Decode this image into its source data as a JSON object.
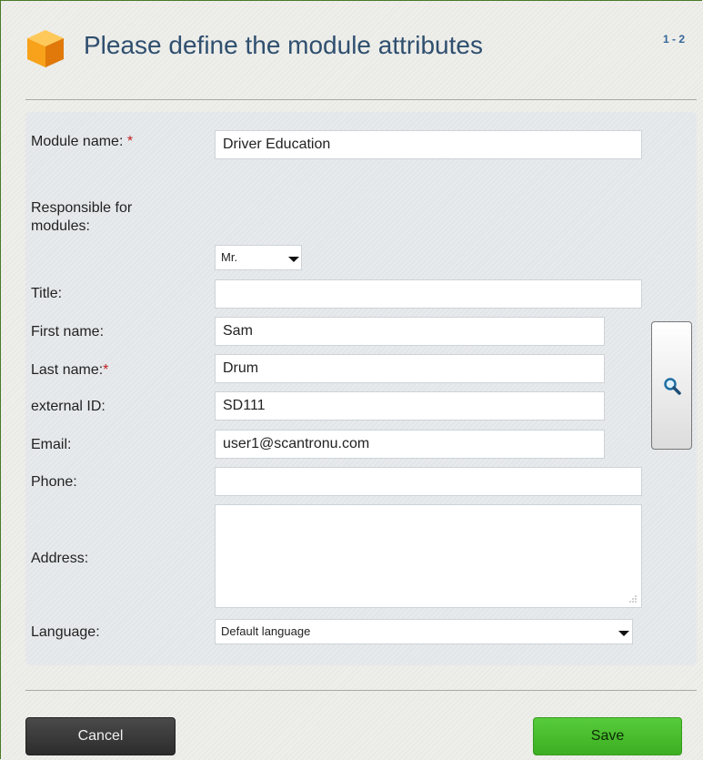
{
  "header": {
    "title": "Please define the module attributes",
    "step": "1 - 2"
  },
  "form": {
    "module_name": {
      "label": "Module name:",
      "required_mark": "*",
      "value": "Driver Education"
    },
    "responsible_heading": {
      "line1": "Responsible for",
      "line2": "modules:"
    },
    "salutation": {
      "value": "Mr."
    },
    "title": {
      "label": "Title:",
      "value": ""
    },
    "first_name": {
      "label": "First name:",
      "value": "Sam"
    },
    "last_name": {
      "label": "Last name:",
      "required_mark": "*",
      "value": "Drum"
    },
    "external_id": {
      "label": "external ID:",
      "value": "SD111"
    },
    "email": {
      "label": "Email:",
      "value": "user1@scantronu.com"
    },
    "phone": {
      "label": "Phone:",
      "value": ""
    },
    "address": {
      "label": "Address:",
      "value": ""
    },
    "language": {
      "label": "Language:",
      "value": "Default language"
    }
  },
  "icons": {
    "module": "cube-icon",
    "lookup": "magnifier-icon",
    "dropdown": "caret-down-icon",
    "resize": "resize-grip-icon"
  },
  "buttons": {
    "cancel": "Cancel",
    "save": "Save"
  },
  "colors": {
    "save_button": "#4cbf2f",
    "cancel_button": "#333333",
    "required": "#c02020",
    "title": "#2f4f6f",
    "cube": "#f7a21a"
  }
}
